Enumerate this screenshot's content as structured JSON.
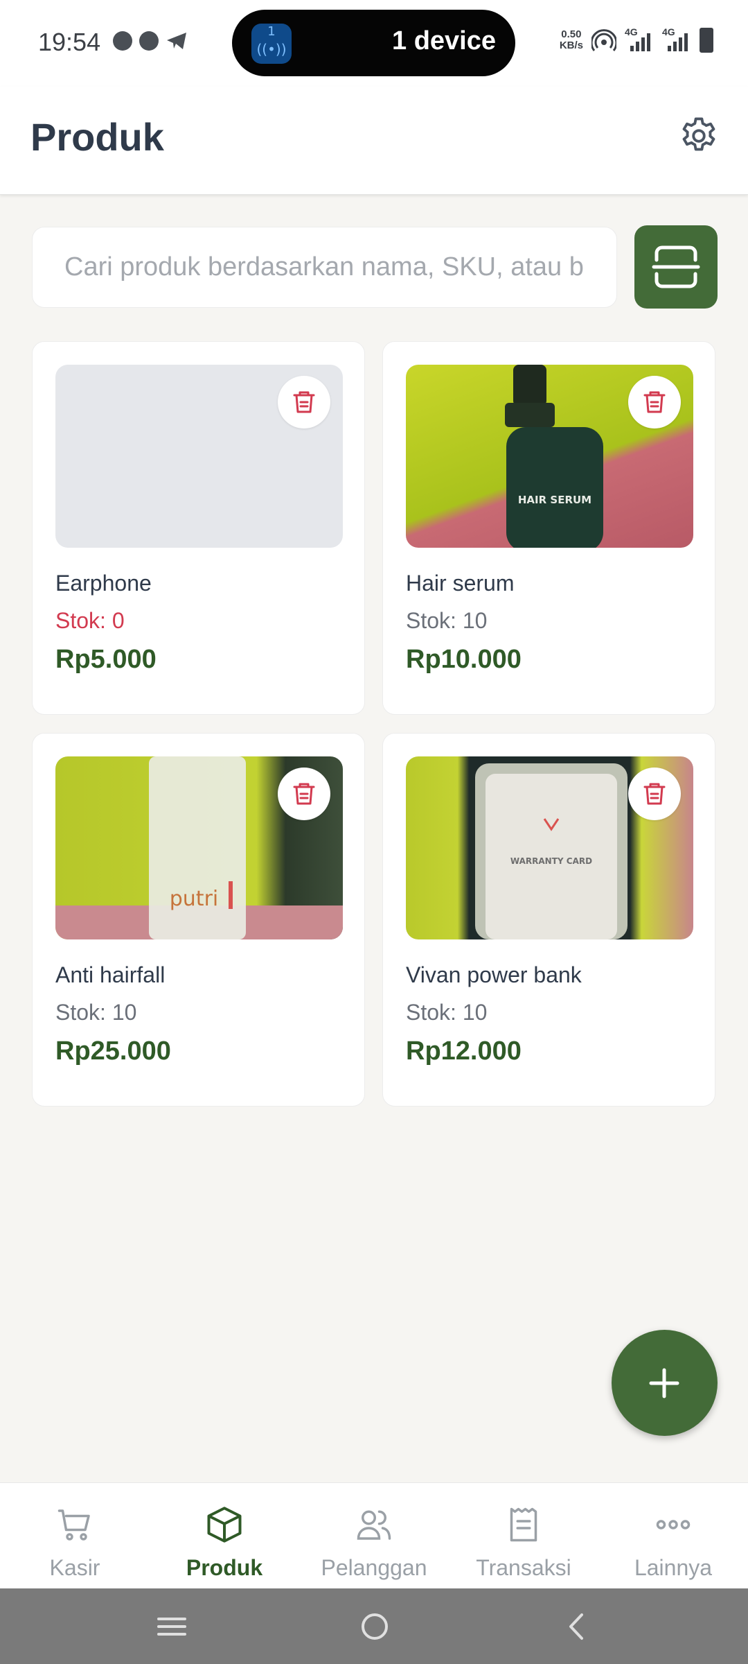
{
  "status_bar": {
    "time": "19:54",
    "pill_badge": "1",
    "pill_text": "1 device",
    "net_speed_value": "0.50",
    "net_speed_unit": "KB/s",
    "network_1": "4G",
    "network_2": "4G"
  },
  "header": {
    "title": "Produk"
  },
  "search": {
    "placeholder": "Cari produk berdasarkan nama, SKU, atau barcode"
  },
  "products": [
    {
      "name": "Earphone",
      "stock": "Stok: 0",
      "price": "Rp5.000",
      "has_image": false
    },
    {
      "name": "Hair serum",
      "stock": "Stok: 10",
      "price": "Rp10.000",
      "has_image": true,
      "image_label": "HAIR SERUM"
    },
    {
      "name": "Anti hairfall",
      "stock": "Stok: 10",
      "price": "Rp25.000",
      "has_image": true,
      "image_label": "putri"
    },
    {
      "name": "Vivan power bank",
      "stock": "Stok: 10",
      "price": "Rp12.000",
      "has_image": true,
      "image_label": "WARRANTY CARD"
    }
  ],
  "bottom_nav": {
    "items": [
      {
        "label": "Kasir",
        "icon": "cart-icon",
        "active": false
      },
      {
        "label": "Produk",
        "icon": "box-icon",
        "active": true
      },
      {
        "label": "Pelanggan",
        "icon": "users-icon",
        "active": false
      },
      {
        "label": "Transaksi",
        "icon": "receipt-icon",
        "active": false
      },
      {
        "label": "Lainnya",
        "icon": "more-icon",
        "active": false
      }
    ]
  },
  "colors": {
    "primary": "#436b38",
    "price": "#2f5a27",
    "danger": "#d23a4f",
    "background": "#f6f5f2"
  }
}
